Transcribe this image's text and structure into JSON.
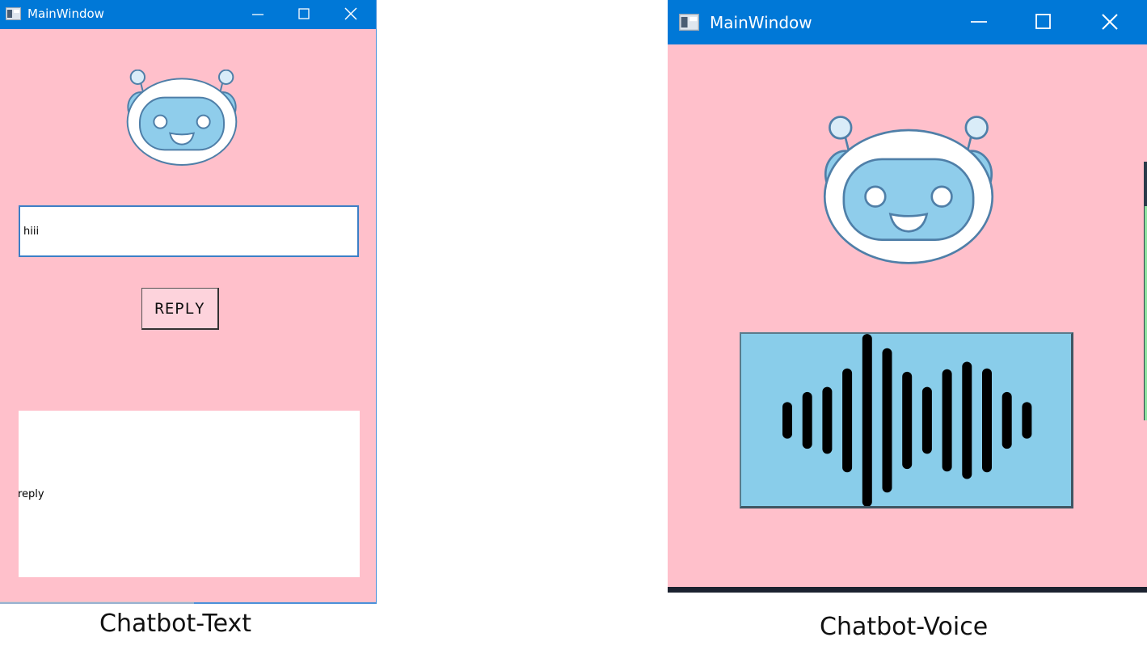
{
  "windows": [
    {
      "title": "MainWindow",
      "input": {
        "value": "hiii"
      },
      "reply_button": {
        "label": "REPLY"
      },
      "output": {
        "text": "reply"
      },
      "caption": "Chatbot-Text"
    },
    {
      "title": "MainWindow",
      "caption": "Chatbot-Voice"
    }
  ],
  "icons": {
    "app": "app-window-icon",
    "minimize": "minimize-icon",
    "maximize": "maximize-icon",
    "close": "close-icon",
    "robot": "robot-mascot-icon",
    "voice": "sound-wave-icon"
  },
  "colors": {
    "window_bg": "#ffc0cb",
    "titlebar": "#0078d7",
    "voice_panel": "#89cdea",
    "robot_face": "#8fcdeb",
    "robot_outline": "#4f7fa8"
  },
  "voice_wave_levels": [
    0.16,
    0.28,
    0.34,
    0.56,
    0.97,
    0.8,
    0.52,
    0.34,
    0.55,
    0.64,
    0.56,
    0.28,
    0.16
  ]
}
